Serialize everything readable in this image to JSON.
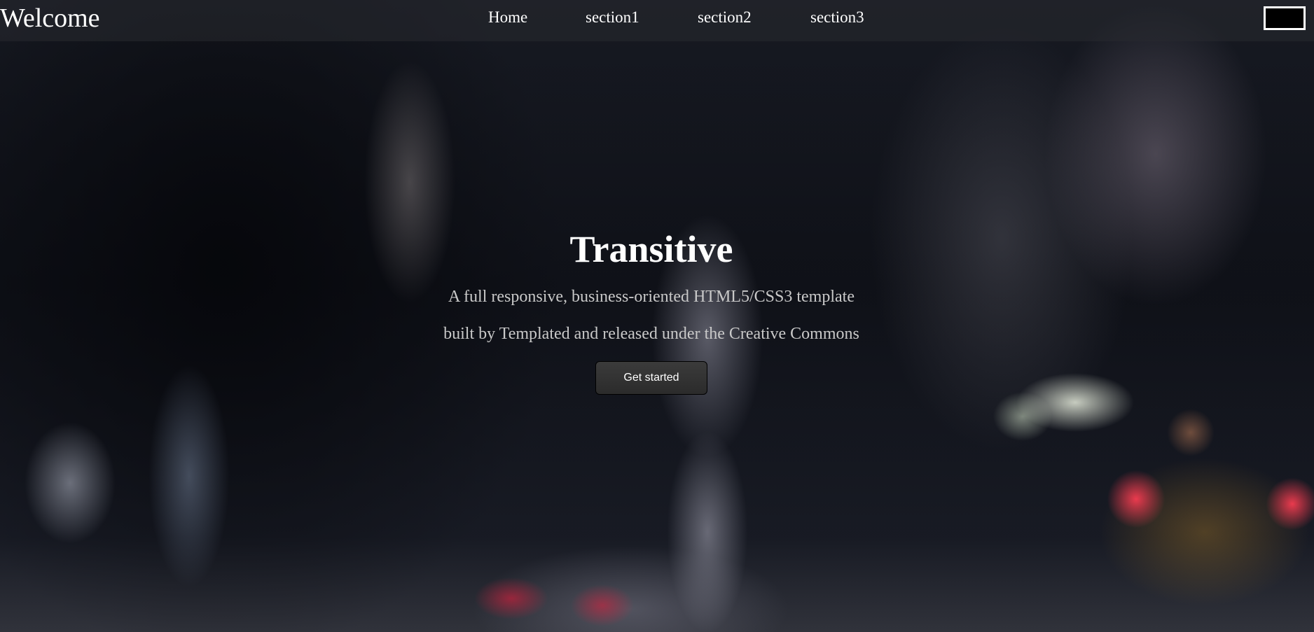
{
  "header": {
    "brand": "Welcome",
    "nav": [
      {
        "label": "Home"
      },
      {
        "label": "section1"
      },
      {
        "label": "section2"
      },
      {
        "label": "section3"
      }
    ],
    "menu_toggle_icon": "menu-toggle-icon"
  },
  "hero": {
    "title": "Transitive",
    "line1": "A full responsive, business-oriented HTML5/CSS3 template",
    "line2": "built by Templated and released under the Creative Commons",
    "cta_label": "Get started"
  },
  "colors": {
    "text_primary": "#ffffff",
    "text_secondary": "#c9c9c9",
    "button_bg": "#333333"
  }
}
